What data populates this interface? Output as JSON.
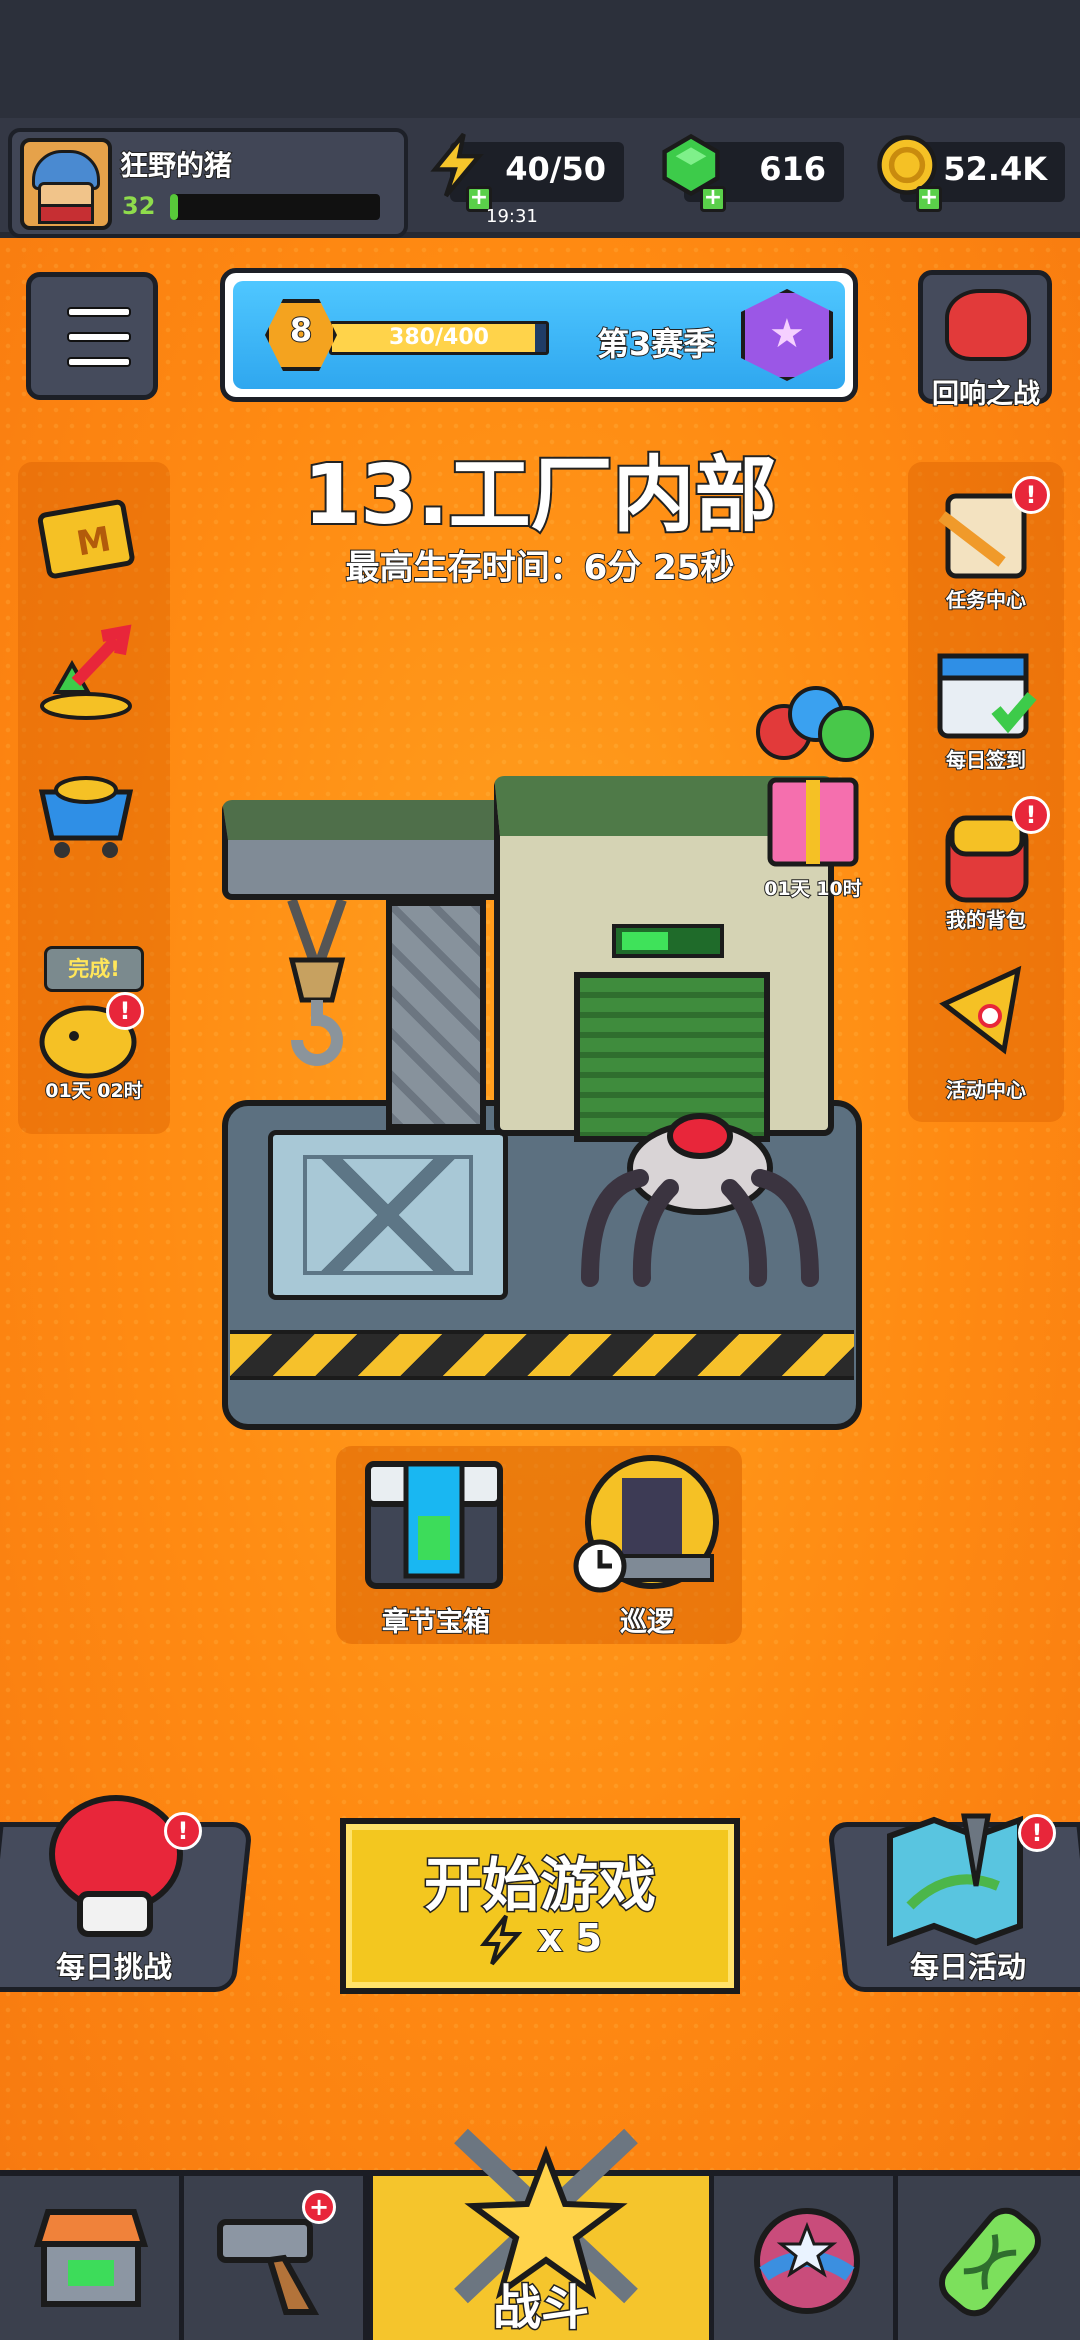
{
  "player": {
    "name": "狂野的猪",
    "level": "32",
    "xp_progress": 0.04
  },
  "resources": {
    "energy": {
      "value": "40/50",
      "timer": "19:31"
    },
    "gems": {
      "value": "616"
    },
    "coins": {
      "value": "52.4K"
    }
  },
  "season": {
    "level": "8",
    "xp": "380/400",
    "xp_progress": 0.95,
    "label": "第3赛季"
  },
  "echo_battle": {
    "label": "回响之战"
  },
  "level": {
    "title": "13.工厂内部",
    "best_time": "最高生存时间：6分 25秒"
  },
  "left_panel": {
    "piggy_bank": {
      "status": "完成!",
      "timer": "01天 02时",
      "badge": "!"
    }
  },
  "right_panel": {
    "items": [
      {
        "label": "任务中心",
        "badge": "!"
      },
      {
        "label": "每日签到"
      },
      {
        "label": "我的背包",
        "badge": "!"
      },
      {
        "label": "活动中心"
      }
    ]
  },
  "gift": {
    "timer": "01天 10时"
  },
  "chapter_chest": {
    "label": "章节宝箱"
  },
  "patrol": {
    "label": "巡逻"
  },
  "daily_challenge": {
    "label": "每日挑战",
    "badge": "!"
  },
  "daily_event": {
    "label": "每日活动",
    "badge": "!"
  },
  "start_game": {
    "label": "开始游戏",
    "cost": "x 5"
  },
  "nav": {
    "fight_label": "战斗",
    "weapons_badge": "+"
  },
  "colors": {
    "background": "#ff8a12",
    "accent": "#f3c71f",
    "badge": "#e8263a",
    "panel": "#454b5c"
  }
}
